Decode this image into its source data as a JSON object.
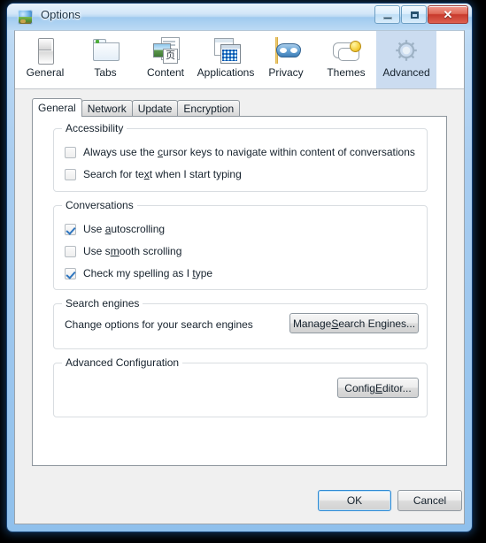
{
  "window": {
    "title": "Options",
    "icon": "globe-icon",
    "controls": {
      "minimize": "minimize-icon",
      "maximize": "maximize-icon",
      "close": "✕"
    }
  },
  "toolbar": {
    "items": [
      {
        "label": "General",
        "icon": "general-toggle-icon",
        "selected": false
      },
      {
        "label": "Tabs",
        "icon": "folder-tabs-icon",
        "selected": false
      },
      {
        "label": "Content",
        "icon": "content-page-icon",
        "selected": false
      },
      {
        "label": "Applications",
        "icon": "applications-icon",
        "selected": false
      },
      {
        "label": "Privacy",
        "icon": "privacy-mask-icon",
        "selected": false
      },
      {
        "label": "Themes",
        "icon": "themes-smiley-icon",
        "selected": false
      },
      {
        "label": "Advanced",
        "icon": "advanced-gear-icon",
        "selected": true
      }
    ]
  },
  "subtabs": [
    {
      "label": "General",
      "active": true
    },
    {
      "label": "Network",
      "active": false
    },
    {
      "label": "Update",
      "active": false
    },
    {
      "label": "Encryption",
      "active": false
    }
  ],
  "groups": {
    "accessibility": {
      "legend": "Accessibility",
      "checkboxes": [
        {
          "pre": "Always use the ",
          "accel": "c",
          "post": "ursor keys to navigate within content of conversations",
          "checked": false
        },
        {
          "pre": "Search for te",
          "accel": "x",
          "post": "t when I start typing",
          "checked": false
        }
      ]
    },
    "conversations": {
      "legend": "Conversations",
      "checkboxes": [
        {
          "pre": "Use ",
          "accel": "a",
          "post": "utoscrolling",
          "checked": true
        },
        {
          "pre": "Use s",
          "accel": "m",
          "post": "ooth scrolling",
          "checked": false
        },
        {
          "pre": "Check my spelling as I ",
          "accel": "t",
          "post": "ype",
          "checked": true
        }
      ]
    },
    "search_engines": {
      "legend": "Search engines",
      "description": "Change options for your search engines",
      "button": {
        "pre": "Manage ",
        "accel": "S",
        "post": "earch Engines..."
      }
    },
    "advanced_configuration": {
      "legend": "Advanced Configuration",
      "button": {
        "pre": "Config ",
        "accel": "E",
        "post": "ditor..."
      }
    }
  },
  "dialog_buttons": {
    "ok": "OK",
    "cancel": "Cancel"
  },
  "colors": {
    "selected_tab": "#cbdcf0",
    "frame_blue": "#2f86d8",
    "dialog_bg": "#f0f0f0",
    "panel_bg": "#ffffff",
    "check_blue": "#2f76bf",
    "close_red": "#c8392c"
  }
}
